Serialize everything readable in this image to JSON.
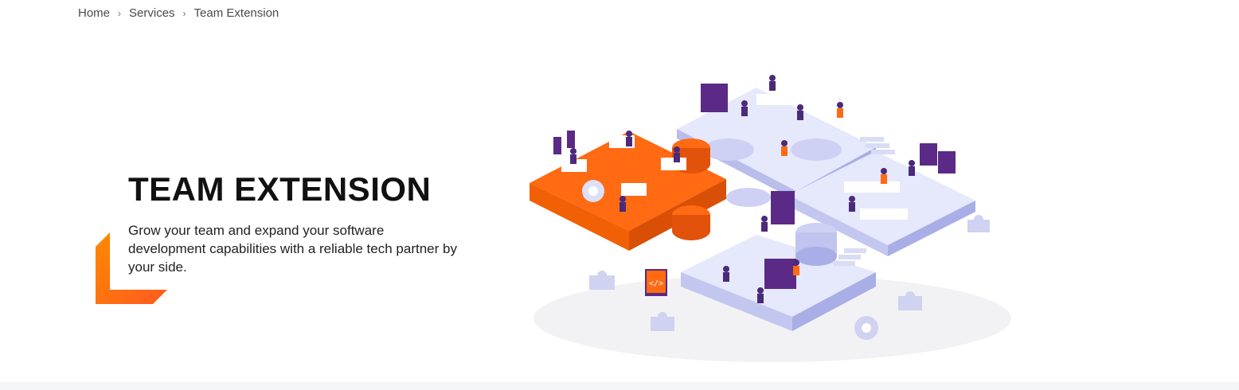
{
  "breadcrumb": {
    "items": [
      {
        "label": "Home"
      },
      {
        "label": "Services"
      },
      {
        "label": "Team Extension"
      }
    ],
    "separator": "›"
  },
  "hero": {
    "title": "TEAM EXTENSION",
    "description": "Grow your team and expand your software development capabilities with a reliable tech partner by your side."
  },
  "illustration": {
    "code_badge": "</>"
  },
  "colors": {
    "accent_orange": "#ff6a13",
    "accent_orange_dark": "#e3520a",
    "tile_lavender": "#e6e8fb",
    "tile_lavender_side": "#a9aee6",
    "purple": "#5b2a86"
  }
}
